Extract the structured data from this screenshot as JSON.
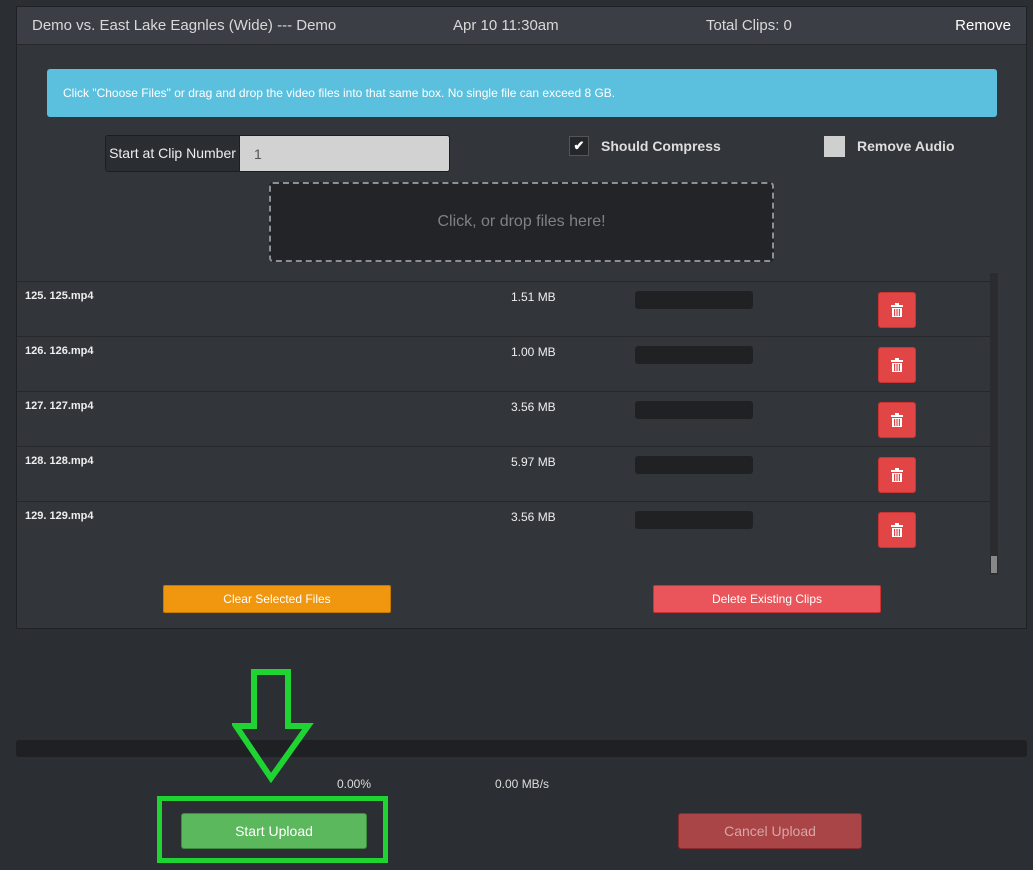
{
  "header": {
    "title": "Demo vs. East Lake Eagnles (Wide) --- Demo",
    "date": "Apr 10 11:30am",
    "total_clips": "Total Clips: 0",
    "remove_label": "Remove"
  },
  "info_text": "Click \"Choose Files\" or drag and drop the video files into that same box. No single file can exceed 8 GB.",
  "clip_number": {
    "label": "Start at Clip Number",
    "value": "1"
  },
  "options": {
    "should_compress": {
      "label": "Should Compress",
      "checked": true
    },
    "remove_audio": {
      "label": "Remove Audio",
      "checked": false
    }
  },
  "dropzone_text": "Click, or drop files here!",
  "files": [
    {
      "name": "125. 125.mp4",
      "size": "1.51 MB"
    },
    {
      "name": "126. 126.mp4",
      "size": "1.00 MB"
    },
    {
      "name": "127. 127.mp4",
      "size": "3.56 MB"
    },
    {
      "name": "128. 128.mp4",
      "size": "5.97 MB"
    },
    {
      "name": "129. 129.mp4",
      "size": "3.56 MB"
    }
  ],
  "buttons": {
    "clear_selected": "Clear Selected Files",
    "delete_existing": "Delete Existing Clips",
    "start_upload": "Start Upload",
    "cancel_upload": "Cancel Upload"
  },
  "progress": {
    "percent_text": "0.00%",
    "speed_text": "0.00 MB/s",
    "fraction": 0
  },
  "colors": {
    "info": "#5bc0de",
    "warning": "#f0960f",
    "danger": "#e24545",
    "success": "#5cb85c",
    "highlight": "#1ed332"
  },
  "icons": {
    "delete": "trash-icon",
    "checkbox": "check-icon",
    "annotation": "down-arrow-icon"
  }
}
